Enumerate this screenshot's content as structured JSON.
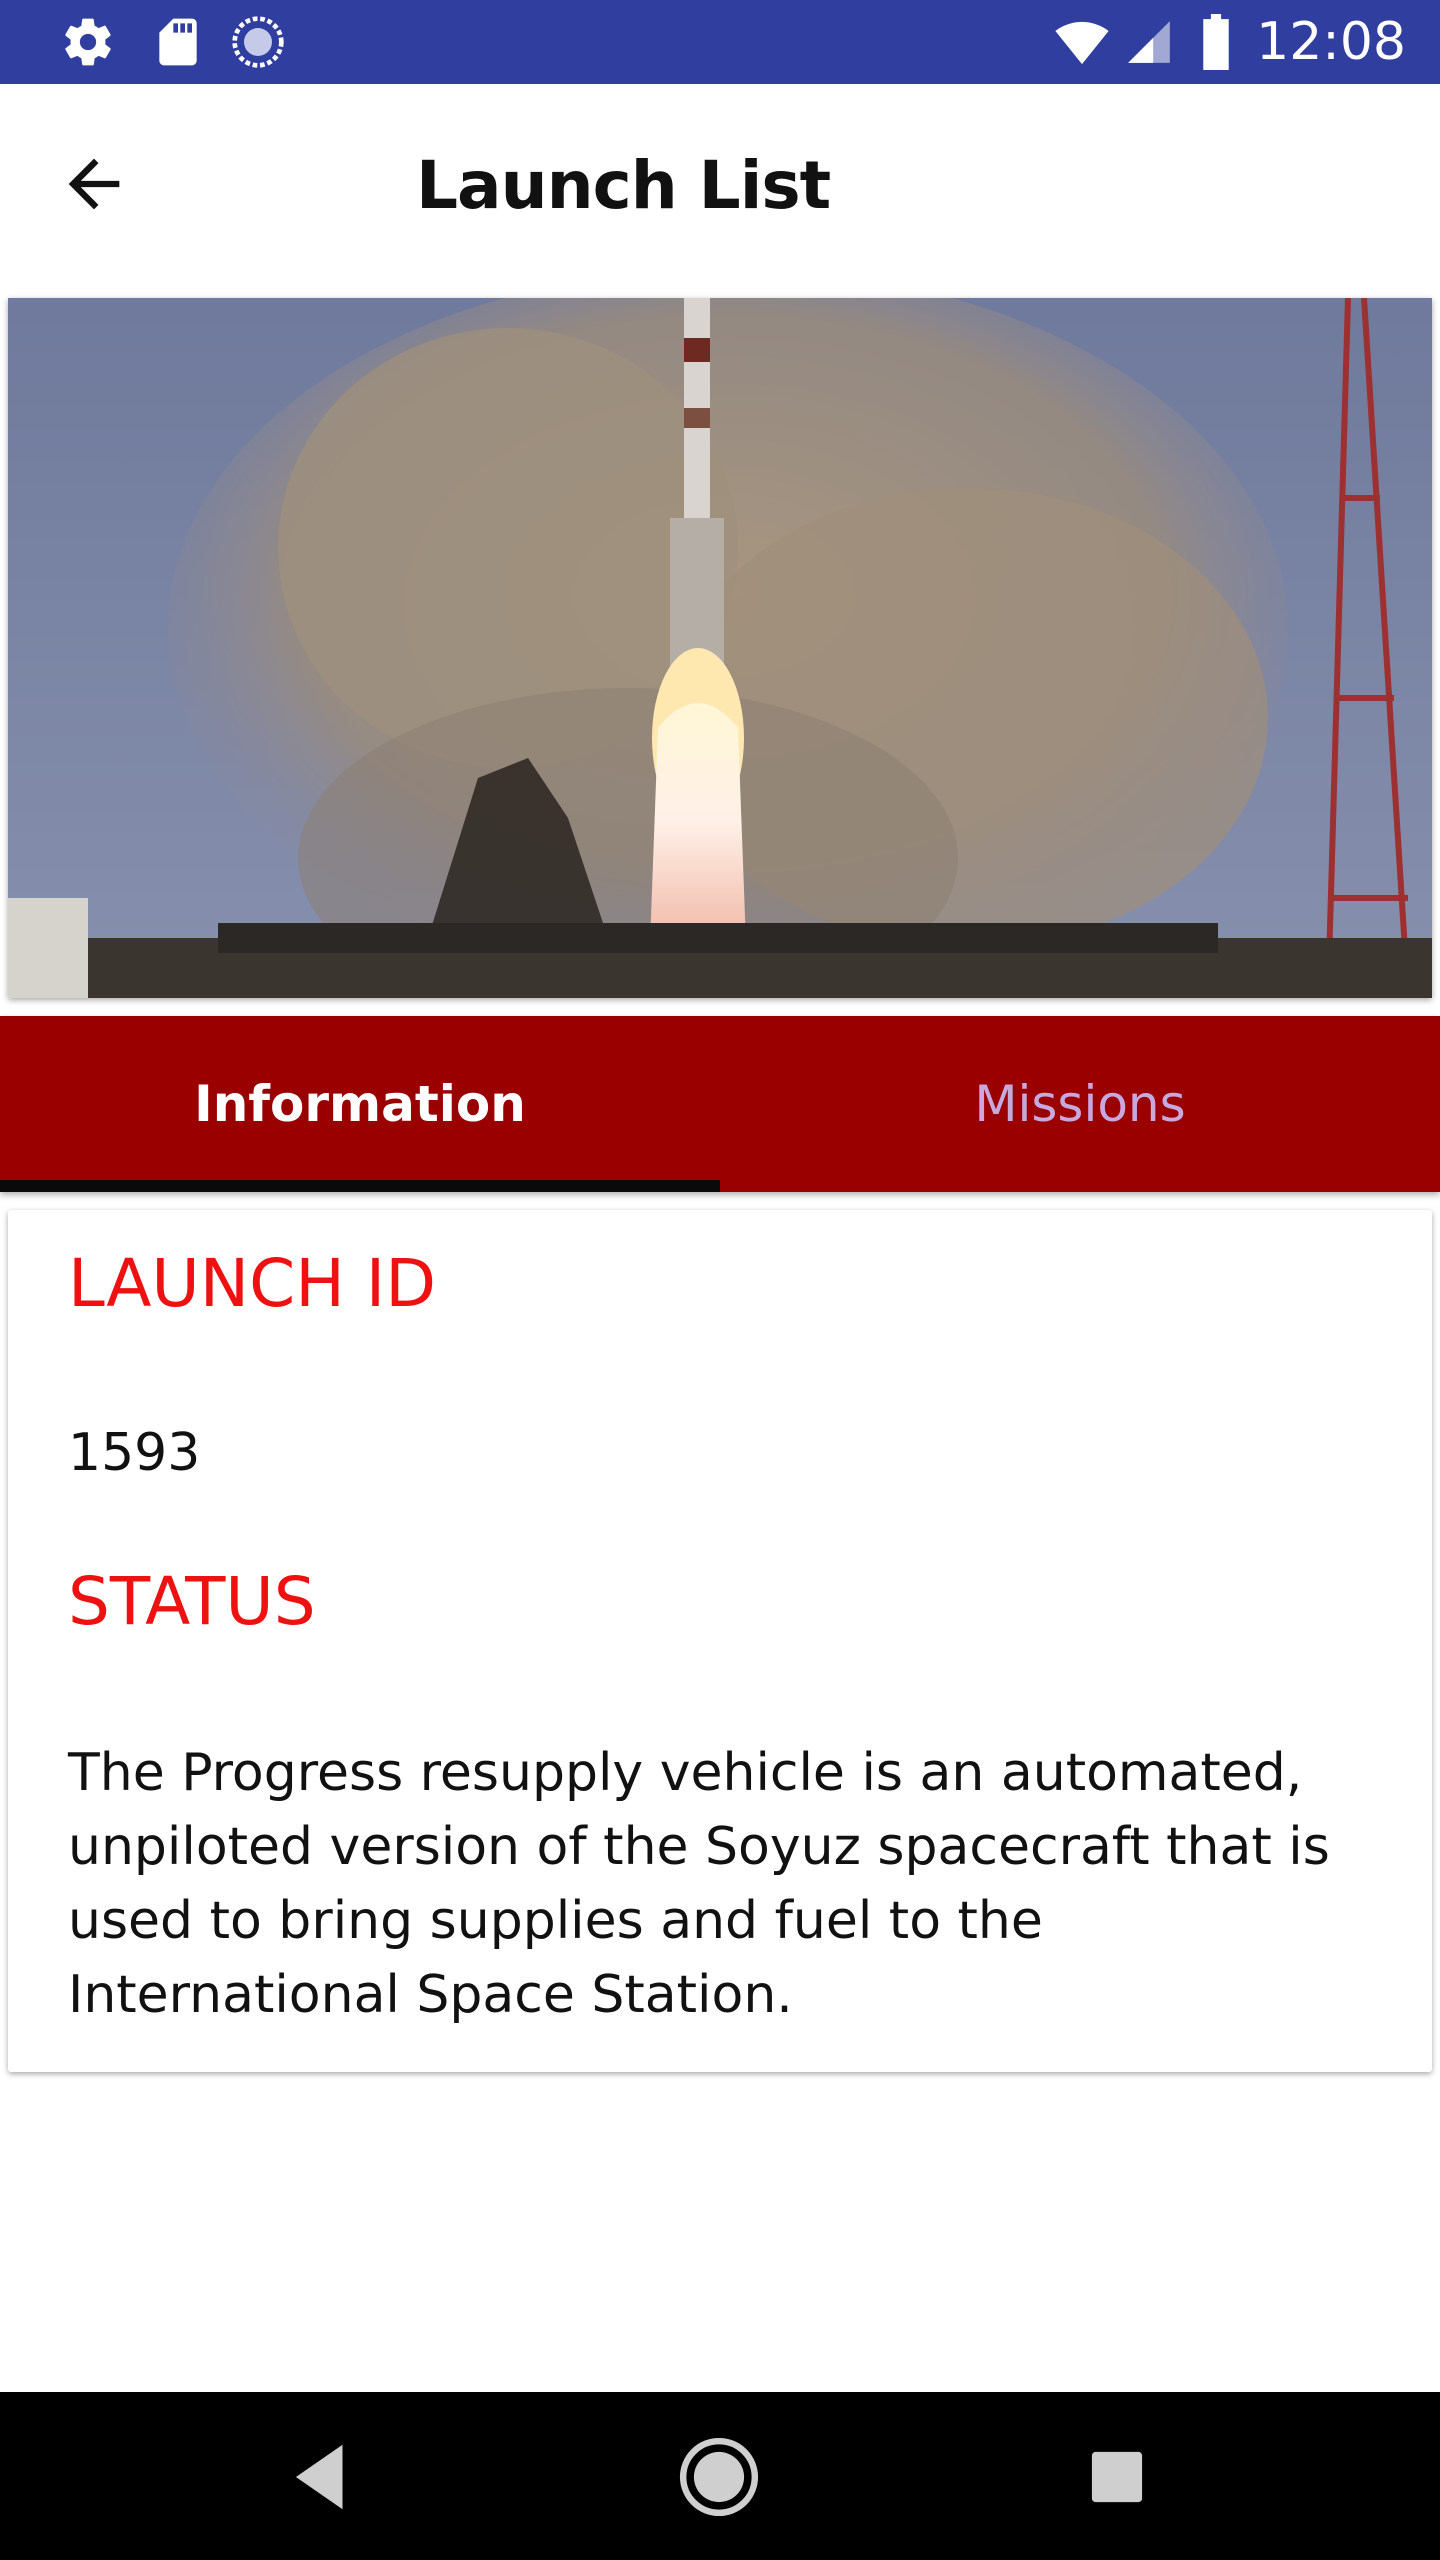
{
  "status_bar": {
    "time": "12:08",
    "icons": [
      "settings-icon",
      "sd-card-icon",
      "loading-icon",
      "wifi-icon",
      "signal-icon",
      "battery-icon"
    ]
  },
  "app_bar": {
    "title": "Launch List",
    "back_icon": "arrow-back-icon"
  },
  "hero": {
    "subject": "rocket-launch-photo"
  },
  "tabs": [
    {
      "label": "Information",
      "active": true
    },
    {
      "label": "Missions",
      "active": false
    }
  ],
  "card": {
    "launch_id_label": "LAUNCH ID",
    "launch_id_value": "1593",
    "status_label": "STATUS",
    "status_value": "The Progress resupply vehicle is an automated, unpiloted version of the Soyuz spacecraft that is used to bring supplies and fuel to the International Space Station."
  },
  "nav_bar": {
    "icons": [
      "back-triangle-icon",
      "home-circle-icon",
      "recents-square-icon"
    ]
  },
  "colors": {
    "status_bar": "#303f9f",
    "tab_bar": "#9b0000",
    "label_red": "#ee1111",
    "tab_inactive_text": "#c7a9e0",
    "tab_indicator": "#0a0a0a"
  }
}
